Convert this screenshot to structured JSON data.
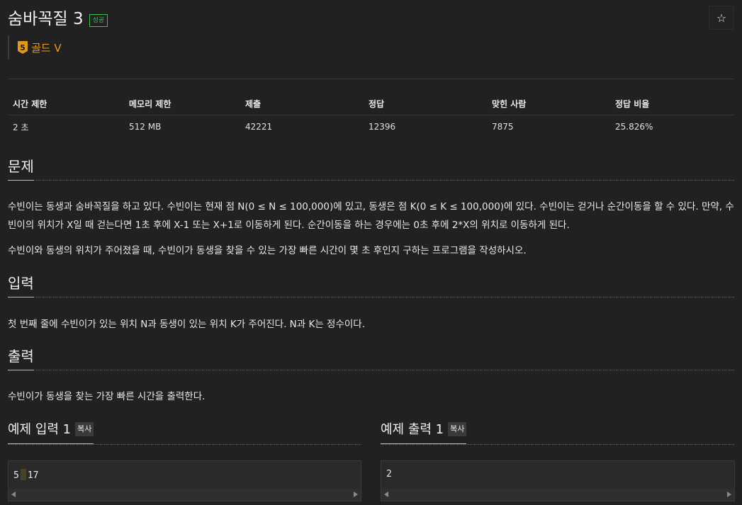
{
  "problem": {
    "title": "숨바꼭질 3",
    "status_badge": "성공",
    "star_icon": "☆",
    "tier_number": "5",
    "tier_label": "골드 V"
  },
  "info_table": {
    "headers": [
      "시간 제한",
      "메모리 제한",
      "제출",
      "정답",
      "맞힌 사람",
      "정답 비율"
    ],
    "values": [
      "2 초",
      "512 MB",
      "42221",
      "12396",
      "7875",
      "25.826%"
    ]
  },
  "sections": {
    "problem_heading": "문제",
    "problem_p1": "수빈이는 동생과 숨바꼭질을 하고 있다. 수빈이는 현재 점 N(0 ≤ N ≤ 100,000)에 있고, 동생은 점 K(0 ≤ K ≤ 100,000)에 있다. 수빈이는 걷거나 순간이동을 할 수 있다. 만약, 수빈이의 위치가 X일 때 걷는다면 1초 후에 X-1 또는 X+1로 이동하게 된다. 순간이동을 하는 경우에는 0초 후에 2*X의 위치로 이동하게 된다.",
    "problem_p2": "수빈이와 동생의 위치가 주어졌을 때, 수빈이가 동생을 찾을 수 있는 가장 빠른 시간이 몇 초 후인지 구하는 프로그램을 작성하시오.",
    "input_heading": "입력",
    "input_text": "첫 번째 줄에 수빈이가 있는 위치 N과 동생이 있는 위치 K가 주어진다. N과 K는 정수이다.",
    "output_heading": "출력",
    "output_text": "수빈이가 동생을 찾는 가장 빠른 시간을 출력한다."
  },
  "samples": {
    "input_heading": "예제 입력 1",
    "output_heading": "예제 출력 1",
    "copy_label": "복사",
    "input_before_cursor": "5",
    "input_after_cursor": "17",
    "output_value": "2"
  },
  "colors": {
    "background": "#212121",
    "success": "#3dbe54",
    "tier_gold": "#ec9a15"
  }
}
